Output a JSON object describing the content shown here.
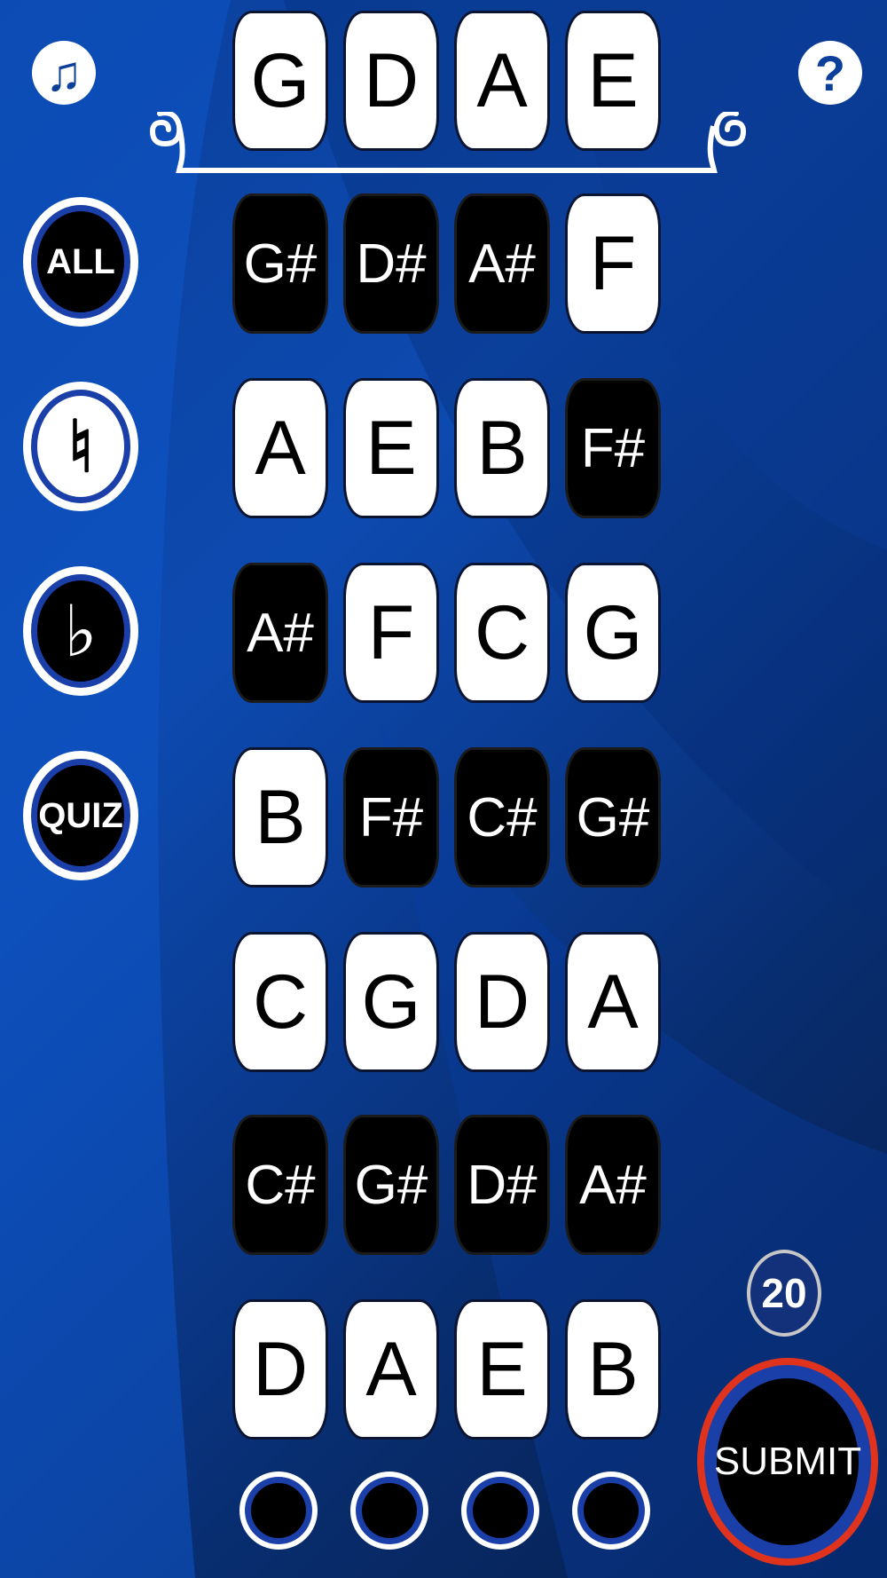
{
  "app": {
    "icons": {
      "music": "music-note-icon",
      "help": "help-icon"
    },
    "help_glyph": "?",
    "music_glyph": "♫"
  },
  "strings_header": {
    "open_strings": [
      "G",
      "D",
      "A",
      "E"
    ]
  },
  "fretboard": {
    "rows": [
      [
        "G#",
        "D#",
        "A#",
        "F"
      ],
      [
        "A",
        "E",
        "B",
        "F#"
      ],
      [
        "A#",
        "F",
        "C",
        "G"
      ],
      [
        "B",
        "F#",
        "C#",
        "G#"
      ],
      [
        "C",
        "G",
        "D",
        "A"
      ],
      [
        "C#",
        "G#",
        "D#",
        "A#"
      ],
      [
        "D",
        "A",
        "E",
        "B"
      ]
    ],
    "sharp_style": "black",
    "natural_style": "white"
  },
  "mode_buttons": {
    "all": "ALL",
    "natural": "♮",
    "flat": "♭",
    "quiz": "QUIZ"
  },
  "counter": {
    "value": "20"
  },
  "submit": {
    "label": "SUBMIT"
  },
  "colors": {
    "accent_blue": "#1a3fa8",
    "submit_ring": "#e0331d",
    "background": "#0b3f9a"
  }
}
